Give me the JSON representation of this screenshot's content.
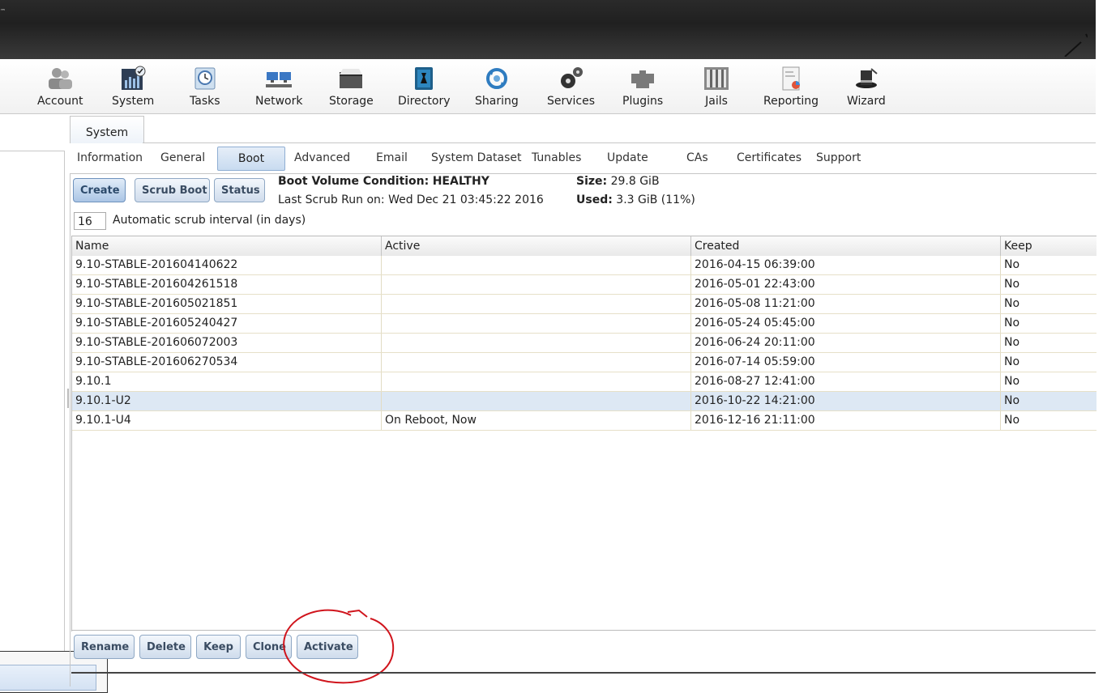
{
  "header": {
    "trademark": "™"
  },
  "toolbar": {
    "items": [
      {
        "label": "Account",
        "icon": "account-icon"
      },
      {
        "label": "System",
        "icon": "system-icon"
      },
      {
        "label": "Tasks",
        "icon": "tasks-icon"
      },
      {
        "label": "Network",
        "icon": "network-icon"
      },
      {
        "label": "Storage",
        "icon": "storage-icon"
      },
      {
        "label": "Directory",
        "icon": "directory-icon"
      },
      {
        "label": "Sharing",
        "icon": "sharing-icon"
      },
      {
        "label": "Services",
        "icon": "services-icon"
      },
      {
        "label": "Plugins",
        "icon": "plugins-icon"
      },
      {
        "label": "Jails",
        "icon": "jails-icon"
      },
      {
        "label": "Reporting",
        "icon": "reporting-icon"
      },
      {
        "label": "Wizard",
        "icon": "wizard-icon"
      }
    ]
  },
  "main": {
    "tab": "System",
    "subtabs": [
      "Information",
      "General",
      "Boot",
      "Advanced",
      "Email",
      "System Dataset",
      "Tunables",
      "Update",
      "CAs",
      "Certificates",
      "Support"
    ],
    "active_subtab": "Boot"
  },
  "boot": {
    "buttons": {
      "create": "Create",
      "scrub": "Scrub Boot",
      "status": "Status"
    },
    "condition_label": "Boot Volume Condition:",
    "condition_value": "HEALTHY",
    "last_scrub": "Last Scrub Run on: Wed Dec 21 03:45:22 2016",
    "size_label": "Size:",
    "size_value": "29.8 GiB",
    "used_label": "Used:",
    "used_value": "3.3 GiB (11%)",
    "interval_value": "16",
    "interval_label": "Automatic scrub interval (in days)"
  },
  "table": {
    "columns": [
      "Name",
      "Active",
      "Created",
      "Keep"
    ],
    "rows": [
      [
        "9.10-STABLE-201604140622",
        "",
        "2016-04-15 06:39:00",
        "No"
      ],
      [
        "9.10-STABLE-201604261518",
        "",
        "2016-05-01 22:43:00",
        "No"
      ],
      [
        "9.10-STABLE-201605021851",
        "",
        "2016-05-08 11:21:00",
        "No"
      ],
      [
        "9.10-STABLE-201605240427",
        "",
        "2016-05-24 05:45:00",
        "No"
      ],
      [
        "9.10-STABLE-201606072003",
        "",
        "2016-06-24 20:11:00",
        "No"
      ],
      [
        "9.10-STABLE-201606270534",
        "",
        "2016-07-14 05:59:00",
        "No"
      ],
      [
        "9.10.1",
        "",
        "2016-08-27 12:41:00",
        "No"
      ],
      [
        "9.10.1-U2",
        "",
        "2016-10-22 14:21:00",
        "No"
      ],
      [
        "9.10.1-U4",
        "On Reboot, Now",
        "2016-12-16 21:11:00",
        "No"
      ]
    ],
    "selected_row": 7
  },
  "actions": {
    "rename": "Rename",
    "delete": "Delete",
    "keep": "Keep",
    "clone": "Clone",
    "activate": "Activate"
  },
  "colors": {
    "annotation": "#d0141c",
    "selected_row": "#dde8f4",
    "button_border": "#8fa8c4"
  }
}
